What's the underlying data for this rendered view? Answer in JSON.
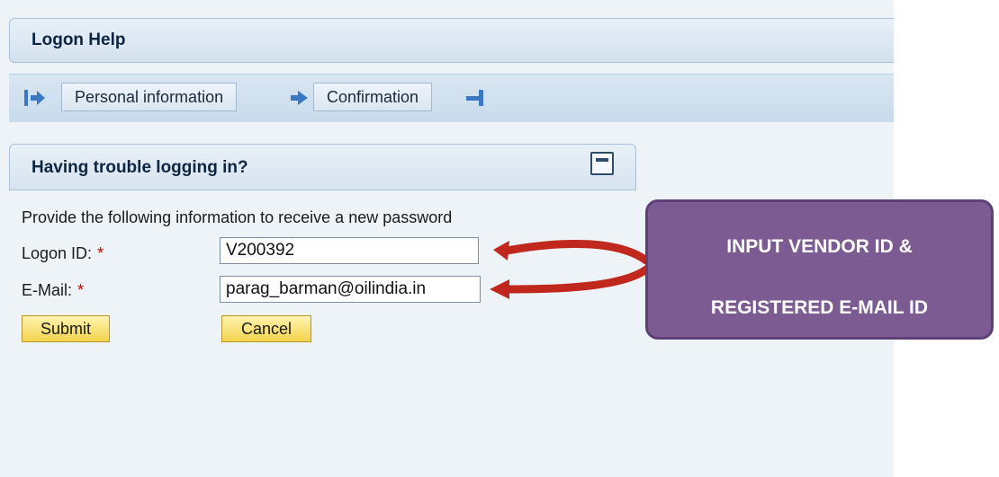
{
  "header": {
    "title": "Logon Help"
  },
  "roadmap": {
    "steps": [
      {
        "label": "Personal information"
      },
      {
        "label": "Confirmation"
      }
    ]
  },
  "panel": {
    "title": "Having trouble logging in?",
    "instructions": "Provide the following information to receive a new password"
  },
  "form": {
    "logon_id_label": "Logon ID:",
    "logon_id_value": "V200392",
    "email_label": "E-Mail:",
    "email_value": "parag_barman@oilindia.in",
    "required_mark": "*",
    "submit_label": "Submit",
    "cancel_label": "Cancel"
  },
  "callout": {
    "line1": "INPUT VENDOR ID &",
    "line2": "REGISTERED E-MAIL ID"
  },
  "colors": {
    "callout_fill": "#7b5b92",
    "arrow_red": "#c0281e",
    "button_yellow": "#f2d44c",
    "roadmap_arrow_blue": "#3a78c4"
  }
}
